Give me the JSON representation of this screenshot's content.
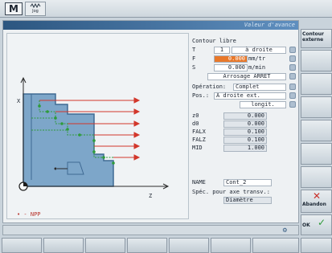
{
  "topbar": {
    "mode_icon": "M",
    "jog_label": "Jog"
  },
  "window": {
    "title": "Valeur d'avance"
  },
  "graphic": {
    "legend": "• - NPP",
    "axis_x": "X",
    "axis_z": "Z"
  },
  "params": {
    "heading": "Contour libre",
    "t_label": "T",
    "t_value": "1",
    "t_side": "à droite",
    "f_label": "F",
    "f_value": "0.000",
    "f_unit": "mm/tr",
    "s_label": "S",
    "s_value": "0.000",
    "s_unit": "m/min",
    "coolant": "Arrosage ARRET",
    "operation_label": "Opération:",
    "operation_value": "Complet",
    "pos_label": "Pos.:",
    "pos_value": "A droite ext.",
    "direction": "longit.",
    "z0_label": "z0",
    "z0_value": "0.000",
    "d0_label": "d0",
    "d0_value": "0.000",
    "falx_label": "FALX",
    "falx_value": "0.100",
    "falz_label": "FALZ",
    "falz_value": "0.100",
    "mid_label": "MID",
    "mid_value": "1.000",
    "name_label": "NAME",
    "name_value": "Cont_2",
    "spec_label": "Spéc. pour axe transv.:",
    "spec_value": "Diamètre"
  },
  "softkeys": {
    "contour": "Contour externe",
    "abandon": "Abandon",
    "ok": "OK"
  },
  "colors": {
    "accent": "#e8782a",
    "title": "#2c5680",
    "path": "#2e9b3a",
    "cut": "#d2372b"
  },
  "icons": [
    "mode-icon",
    "jog-icon",
    "cancel-icon",
    "check-icon",
    "toggle-icon",
    "status-icon"
  ]
}
